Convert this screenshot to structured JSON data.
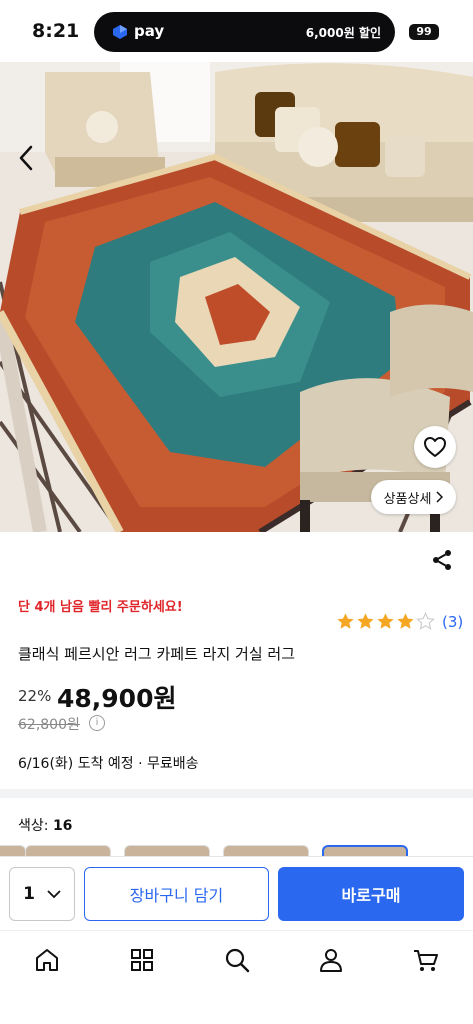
{
  "status_bar": {
    "time": "8:21",
    "pay_label": "pay",
    "promo": "6,000원 할인",
    "battery": "99"
  },
  "hero": {
    "detail_button": "상품상세"
  },
  "product": {
    "urgency_prefix": "단 ",
    "urgency_count": "4개",
    "urgency_suffix": " 남음 빨리 주문하세요!",
    "rating_stars": 4,
    "rating_count": "(3)",
    "title": "클래식 페르시안 러그 카페트 라지 거실 러그",
    "discount": "22%",
    "price": "48,900원",
    "original_price": "62,800원",
    "delivery": "6/16(화) 도착 예정 · 무료배송"
  },
  "options": {
    "color_label": "색상:",
    "color_value": "16"
  },
  "action_bar": {
    "quantity": "1",
    "cart_label": "장바구니 담기",
    "buy_label": "바로구매"
  },
  "bottom_nav": {
    "items": [
      "home-icon",
      "category-grid-icon",
      "search-icon",
      "user-icon",
      "cart-icon"
    ]
  },
  "colors": {
    "accent": "#2a68f0",
    "urgent": "#e0252a",
    "star": "#f5a623"
  }
}
